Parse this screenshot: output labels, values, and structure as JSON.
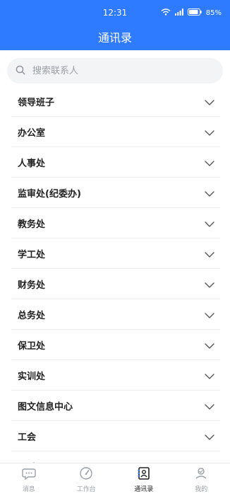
{
  "status_bar": {
    "time": "12:31",
    "battery": "85%"
  },
  "header": {
    "title": "通讯录"
  },
  "search": {
    "placeholder": "搜索联系人"
  },
  "contacts": {
    "groups": [
      "领导班子",
      "办公室",
      "人事处",
      "监审处(纪委办)",
      "教务处",
      "学工处",
      "财务处",
      "总务处",
      "保卫处",
      "实训处",
      "图文信息中心",
      "工会",
      "团委"
    ]
  },
  "tabbar": {
    "tabs": [
      {
        "label": "消息",
        "icon": "chat-bubble-icon"
      },
      {
        "label": "工作台",
        "icon": "dashboard-gauge-icon"
      },
      {
        "label": "通讯录",
        "icon": "contacts-book-icon",
        "active": true
      },
      {
        "label": "我的",
        "icon": "user-profile-icon"
      }
    ]
  },
  "colors": {
    "header_bg": "#2f7bff",
    "active_tab": "#222222",
    "inactive_tab": "#9aa0a6"
  }
}
